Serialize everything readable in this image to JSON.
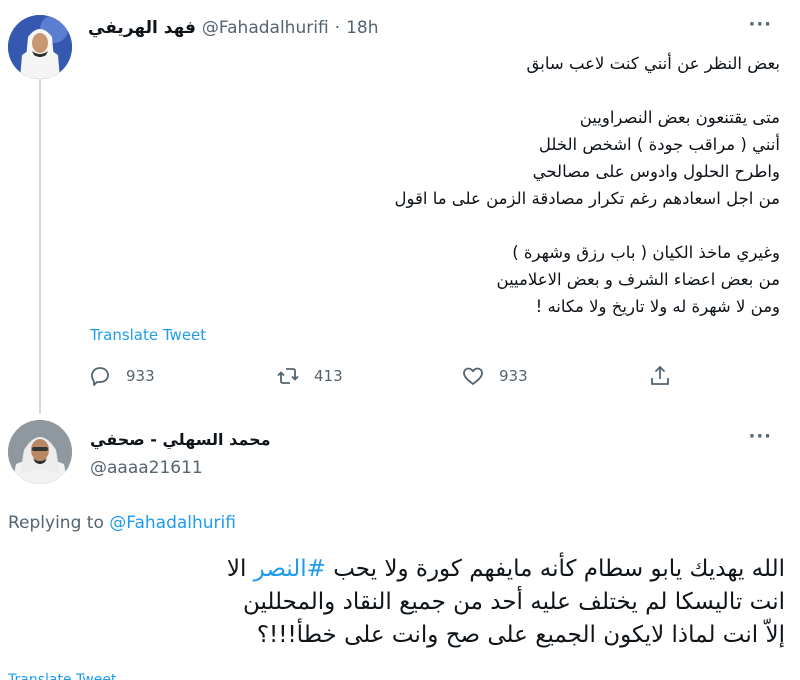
{
  "tweet": {
    "display_name": "فهد الهريفي",
    "handle": "@Fahadalhurifi",
    "separator": "·",
    "time": "18h",
    "lines": [
      "بعض النظر عن أنني كنت لاعب سابق",
      "",
      "متى يقتنعون بعض النصراويين",
      "أنني ( مراقب جودة ) اشخص الخلل",
      "واطرح الحلول وادوس على مصالحي",
      "من اجل اسعادهم رغم تكرار مصادقة الزمن على ما اقول",
      "",
      "وغيري ماخذ الكيان ( باب رزق وشهرة )",
      "من بعض اعضاء الشرف و بعض الاعلاميين",
      "ومن لا شهرة له ولا تاريخ ولا مكانه !"
    ],
    "translate_label": "Translate Tweet",
    "actions": {
      "replies": "933",
      "retweets": "413",
      "likes": "933"
    }
  },
  "reply": {
    "display_name": "محمد السهلي - صحفي",
    "handle": "@aaaa21611",
    "replying_prefix": "Replying to",
    "replying_to": "@Fahadalhurifi",
    "line1_before": "الله يهديك يابو سطام كأنه مايفهم كورة ولا يحب ",
    "hashtag": "#النصر",
    "line1_after": " الا",
    "line2": "انت تاليسكا لم يختلف عليه أحد من جميع النقاد والمحللين",
    "line3": "إلاّ انت لماذا لايكون الجميع على صح وانت على خطأ!!!؟",
    "cut_label": "Translate Tweet"
  },
  "icons": {
    "more": "more-horizontal-icon",
    "reply": "reply-bubble-icon",
    "retweet": "retweet-icon",
    "like": "heart-icon",
    "share": "share-icon"
  },
  "colors": {
    "accent": "#1d9bf0",
    "muted": "#536471",
    "text": "#0f1419",
    "thread_line": "#cfd9de"
  }
}
